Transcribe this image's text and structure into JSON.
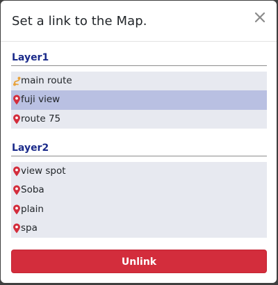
{
  "modal": {
    "title": "Set a link to the Map.",
    "close_icon": "close-icon"
  },
  "layers": [
    {
      "title": "Layer1",
      "items": [
        {
          "label": "main route",
          "icon": "route-icon",
          "selected": false
        },
        {
          "label": "fuji view",
          "icon": "map-pin-icon",
          "selected": true
        },
        {
          "label": "route 75",
          "icon": "map-pin-icon",
          "selected": false
        }
      ]
    },
    {
      "title": "Layer2",
      "items": [
        {
          "label": "view spot",
          "icon": "map-pin-icon",
          "selected": false
        },
        {
          "label": "Soba",
          "icon": "map-pin-icon",
          "selected": false
        },
        {
          "label": "plain",
          "icon": "map-pin-icon",
          "selected": false
        },
        {
          "label": "spa",
          "icon": "map-pin-icon",
          "selected": false
        }
      ]
    }
  ],
  "footer": {
    "unlink_label": "Unlink"
  },
  "colors": {
    "layer_title": "#1a2a8a",
    "list_bg": "#e7e9f0",
    "selected_bg": "#b9c0e2",
    "pin": "#d32d3c",
    "route": "#e8a23a",
    "danger": "#d32d3c"
  }
}
